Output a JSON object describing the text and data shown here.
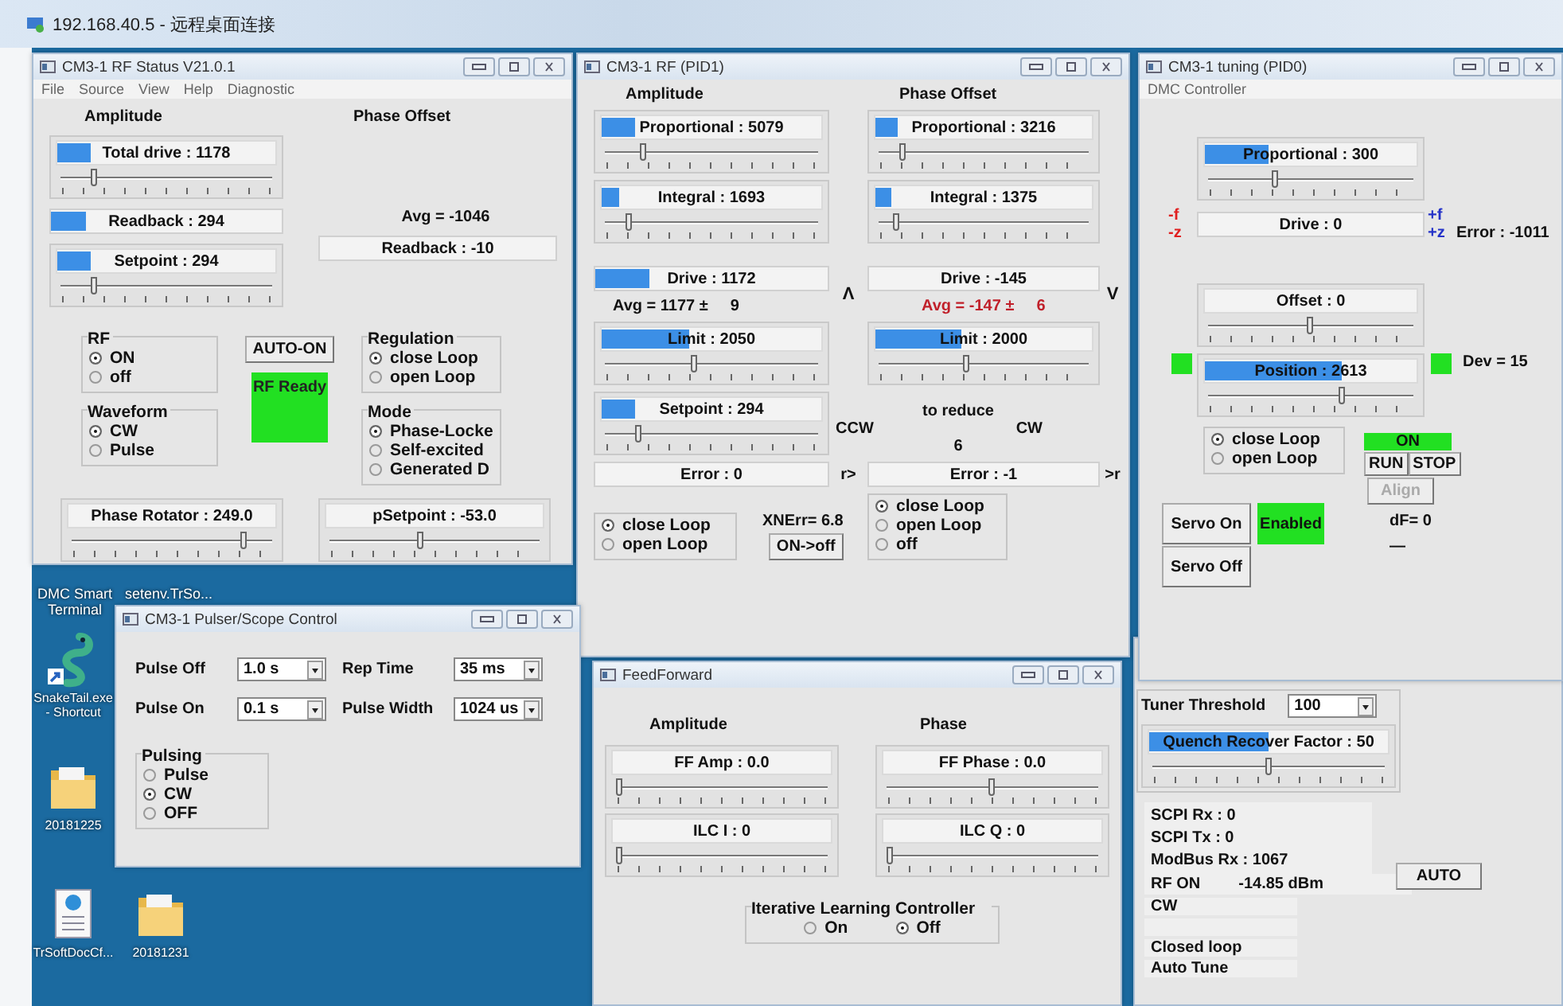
{
  "remote_title": "192.168.40.5 - 远程桌面连接",
  "desktop": {
    "labels": [
      "DMC Smart Terminal",
      "setenv.TrSo..."
    ],
    "icons": [
      {
        "label": "SnakeTail.exe - Shortcut",
        "kind": "snake"
      },
      {
        "label": "20181225",
        "kind": "folder"
      },
      {
        "label": "TrSoftDocCf...",
        "kind": "document"
      },
      {
        "label": "20181231",
        "kind": "folder"
      }
    ]
  },
  "rf_status": {
    "title": "CM3-1 RF Status V21.0.1",
    "menu": [
      "File",
      "Source",
      "View",
      "Help",
      "Diagnostic"
    ],
    "amplitude_heading": "Amplitude",
    "phase_heading": "Phase Offset",
    "total_drive": {
      "label": "Total drive : 1178",
      "meter": {
        "level": 0.15
      },
      "level": 0.15
    },
    "readback": {
      "label": "Readback : 294",
      "meter": {
        "level": 0.15
      }
    },
    "setpoint": {
      "label": "Setpoint : 294",
      "meter": {
        "level": 0.15
      },
      "level": 0.15
    },
    "phase_avg": "Avg = -1046",
    "phase_readback": {
      "label": "Readback : -10"
    },
    "rf": {
      "title": "RF",
      "options": [
        {
          "label": "ON",
          "selected": true
        },
        {
          "label": "off",
          "selected": false
        }
      ]
    },
    "waveform": {
      "title": "Waveform",
      "options": [
        {
          "label": "CW",
          "selected": true
        },
        {
          "label": "Pulse",
          "selected": false
        }
      ]
    },
    "auto_button": "AUTO-ON",
    "status": "RF Ready",
    "regulation": {
      "title": "Regulation",
      "options": [
        {
          "label": "close Loop",
          "selected": true
        },
        {
          "label": "open Loop",
          "selected": false
        }
      ]
    },
    "mode": {
      "title": "Mode",
      "options": [
        {
          "label": "Phase-Locke",
          "selected": true
        },
        {
          "label": "Self-excited",
          "selected": false
        },
        {
          "label": "Generated D",
          "selected": false
        }
      ]
    },
    "phase_rotator": {
      "label": "Phase Rotator : 249.0",
      "level": 0.88
    },
    "psetpoint": {
      "label": "pSetpoint : -53.0",
      "level": 0.43
    }
  },
  "pid1": {
    "title": "CM3-1 RF (PID1)",
    "amplitude_heading": "Amplitude",
    "phase_heading": "Phase Offset",
    "amp_proportional": {
      "label": "Proportional : 5079",
      "meter": {
        "level": 0.15
      },
      "level": 0.17
    },
    "phase_proportional": {
      "label": "Proportional : 3216",
      "meter": {
        "level": 0.1
      },
      "level": 0.1
    },
    "amp_integral": {
      "label": "Integral : 1693",
      "meter": {
        "level": 0.08
      },
      "level": 0.1
    },
    "phase_integral": {
      "label": "Integral : 1375",
      "meter": {
        "level": 0.07
      },
      "level": 0.07
    },
    "amp_drive": {
      "label": "Drive : 1172",
      "meter": {
        "level": 0.23
      }
    },
    "phase_drive": {
      "label": "Drive : -145"
    },
    "amp_arrow": "Λ",
    "phase_arrow": "V",
    "amp_avg": {
      "text": "Avg = 1177 ±",
      "spread": "9",
      "alert": false
    },
    "phase_avg": {
      "text": "Avg = -147 ±",
      "spread": "6",
      "alert": true
    },
    "amp_limit": {
      "label": "Limit : 2050",
      "meter": {
        "level": 0.4
      },
      "level": 0.42
    },
    "phase_limit": {
      "label": "Limit : 2000",
      "meter": {
        "level": 0.4
      },
      "level": 0.42
    },
    "setpoint": {
      "label": "Setpoint : 294",
      "meter": {
        "level": 0.15
      },
      "level": 0.15
    },
    "hint": "to reduce",
    "ccw": "CCW",
    "cw": "CW",
    "hint_value": "6",
    "amp_error": {
      "label": "Error : 0"
    },
    "amp_error_arrow": "r>",
    "phase_error": {
      "label": "Error : -1"
    },
    "phase_error_arrow": ">r",
    "amp_loop": {
      "options": [
        {
          "label": "close Loop",
          "selected": true
        },
        {
          "label": "open Loop",
          "selected": false
        }
      ]
    },
    "xnerr": "XNErr= 6.8",
    "toggle_button": "ON->off",
    "phase_loop": {
      "options": [
        {
          "label": "close Loop",
          "selected": true
        },
        {
          "label": "open Loop",
          "selected": false
        },
        {
          "label": "off",
          "selected": false
        }
      ]
    }
  },
  "tuner": {
    "threshold_label": "Tuner Threshold",
    "threshold_value": "100",
    "quench": {
      "label": "Quench Recover Factor : 50",
      "meter": {
        "level": 0.5
      },
      "level": 0.5
    },
    "comm": [
      "SCPI Rx : 0",
      "SCPI Tx : 0",
      "ModBus Rx : 1067"
    ],
    "auto_button": "AUTO",
    "rf_state": "RF ON",
    "power": "-14.85 dBm",
    "status_top": [
      "CW"
    ],
    "status_bottom": [
      "Closed loop",
      "Auto Tune"
    ]
  },
  "pid0": {
    "title": "CM3-1 tuning (PID0)",
    "menu": "DMC Controller",
    "proportional": {
      "label": "Proportional : 300",
      "meter": {
        "level": 0.3
      },
      "level": 0.32
    },
    "minus_f": "-f",
    "minus_z": "-z",
    "plus_f": "+f",
    "plus_z": "+z",
    "drive": {
      "label": "Drive : 0"
    },
    "error": "Error : -1011",
    "offset": {
      "label": "Offset : 0",
      "level": 0.5
    },
    "left_indicator": {
      "on": true
    },
    "right_indicator": {
      "on": true
    },
    "position": {
      "label": "Position : 2613",
      "meter": {
        "level": 0.65
      },
      "level": 0.66
    },
    "dev": "Dev = 15",
    "loop": {
      "options": [
        {
          "label": "close Loop",
          "selected": true
        },
        {
          "label": "open Loop",
          "selected": false
        }
      ]
    },
    "run_state": {
      "label": "ON",
      "on": true
    },
    "run_button": "RUN",
    "stop_button": "STOP",
    "align_button": {
      "label": "Align",
      "disabled": true
    },
    "df": "dF= 0",
    "dash": "—",
    "servo_on": "Servo On",
    "servo_state": {
      "label": "Enabled",
      "on": true
    },
    "servo_off": "Servo Off"
  },
  "pulser": {
    "title": "CM3-1 Pulser/Scope Control",
    "fields": [
      {
        "label": "Pulse Off",
        "value": "1.0 s"
      },
      {
        "label": "Rep Time",
        "value": "35 ms"
      },
      {
        "label": "Pulse On",
        "value": "0.1 s"
      },
      {
        "label": "Pulse Width",
        "value": "1024 us"
      }
    ],
    "pulsing": {
      "title": "Pulsing",
      "options": [
        {
          "label": "Pulse",
          "selected": false
        },
        {
          "label": "CW",
          "selected": true
        },
        {
          "label": "OFF",
          "selected": false
        }
      ]
    }
  },
  "feedforward": {
    "title": "FeedForward",
    "amplitude_heading": "Amplitude",
    "phase_heading": "Phase",
    "sliders": [
      {
        "label": "FF Amp : 0.0",
        "level": 0
      },
      {
        "label": "FF Phase : 0.0",
        "level": 0.5
      },
      {
        "label": "ILC I : 0",
        "level": 0
      },
      {
        "label": "ILC Q : 0",
        "level": 0
      }
    ],
    "ilc": {
      "title": "Iterative Learning Controller",
      "options": [
        {
          "label": "On",
          "selected": false
        },
        {
          "label": "Off",
          "selected": true
        }
      ]
    }
  }
}
